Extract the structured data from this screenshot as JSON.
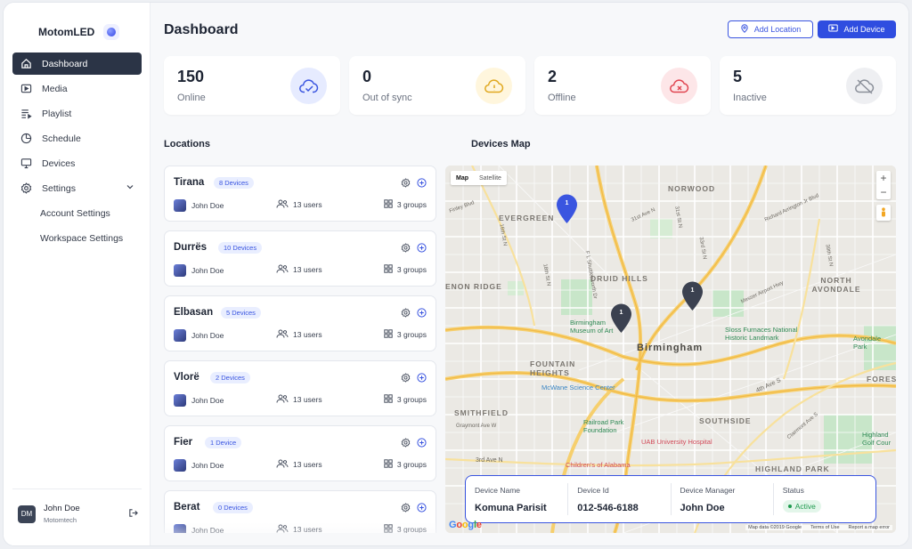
{
  "brand": {
    "name": "MotomLED"
  },
  "sidebar": {
    "items": [
      {
        "label": "Dashboard",
        "icon": "home-icon"
      },
      {
        "label": "Media",
        "icon": "media-icon"
      },
      {
        "label": "Playlist",
        "icon": "playlist-icon"
      },
      {
        "label": "Schedule",
        "icon": "schedule-icon"
      },
      {
        "label": "Devices",
        "icon": "monitor-icon"
      },
      {
        "label": "Settings",
        "icon": "gear-icon"
      }
    ],
    "sub_items": [
      {
        "label": "Account Settings"
      },
      {
        "label": "Workspace Settings"
      }
    ],
    "user": {
      "initials": "DM",
      "name": "John Doe",
      "company": "Motomtech"
    }
  },
  "header": {
    "title": "Dashboard",
    "add_location_label": "Add Location",
    "add_device_label": "Add Device"
  },
  "stats": [
    {
      "value": "150",
      "label": "Online",
      "icon": "cloud-check-icon",
      "color": "#3a55e0",
      "bg": "#e6ebff"
    },
    {
      "value": "0",
      "label": "Out of sync",
      "icon": "cloud-alert-icon",
      "color": "#e0a81f",
      "bg": "#fff6dd"
    },
    {
      "value": "2",
      "label": "Offline",
      "icon": "cloud-x-icon",
      "color": "#e04450",
      "bg": "#fde6e8"
    },
    {
      "value": "5",
      "label": "Inactive",
      "icon": "cloud-off-icon",
      "color": "#8a8f99",
      "bg": "#eeeff2"
    }
  ],
  "locations": {
    "title": "Locations",
    "items": [
      {
        "city": "Tirana",
        "devices": "8 Devices",
        "owner": "John Doe",
        "users": "13 users",
        "groups": "3 groups"
      },
      {
        "city": "Durrës",
        "devices": "10 Devices",
        "owner": "John Doe",
        "users": "13 users",
        "groups": "3 groups"
      },
      {
        "city": "Elbasan",
        "devices": "5 Devices",
        "owner": "John Doe",
        "users": "13 users",
        "groups": "3 groups"
      },
      {
        "city": "Vlorë",
        "devices": "2 Devices",
        "owner": "John Doe",
        "users": "13 users",
        "groups": "3 groups"
      },
      {
        "city": "Fier",
        "devices": "1 Device",
        "owner": "John Doe",
        "users": "13 users",
        "groups": "3 groups"
      },
      {
        "city": "Berat",
        "devices": "0 Devices",
        "owner": "John Doe",
        "users": "13 users",
        "groups": "3 groups"
      }
    ]
  },
  "map": {
    "title": "Devices Map",
    "toggle": {
      "map": "Map",
      "satellite": "Satellite"
    },
    "zoom_in": "+",
    "zoom_out": "−",
    "labels": {
      "norwood": "NORWOOD",
      "evergreen": "EVERGREEN",
      "druid_hills": "DRUID HILLS",
      "enon_ridge": "ENON RIDGE",
      "north_avondale": "NORTH AVONDALE",
      "birmingham": "Birmingham",
      "fountain_heights": "FOUNTAIN HEIGHTS",
      "smithfield": "SMITHFIELD",
      "southside": "SOUTHSIDE",
      "highland_park": "HIGHLAND PARK",
      "fores": "FORES",
      "museum": "Birmingham Museum of Art",
      "sloss": "Sloss Furnaces National Historic Landmark",
      "mcwane": "McWane Science Center",
      "railroad": "Railroad Park Foundation",
      "uab": "UAB University Hospital",
      "childrens": "Children's of Alabama",
      "avondale_park": "Avondale Park",
      "highland_golf": "Highland Golf Cour",
      "finley": "Finley Blvd",
      "ave_31": "31st Ave N",
      "st_16": "16th St N",
      "st_18": "18th St N",
      "st_31": "31st St N",
      "st_33": "33rd St N",
      "st_39": "39th St N",
      "richard_arrington": "Richard Arrington Jr Blvd",
      "messer": "Messer Airport Hwy",
      "shuttlesworth": "F L Shuttlesworth Dr",
      "ave_4th": "4th Ave S",
      "ave_3rd": "3rd Ave N",
      "graymont": "Graymont Ave W",
      "clairmont": "Clairmont Ave S"
    },
    "pins": [
      {
        "count": "1",
        "color": "#3a55e0"
      },
      {
        "count": "1",
        "color": "#3b4150"
      },
      {
        "count": "1",
        "color": "#3b4150"
      }
    ],
    "info": {
      "device_name_label": "Device Name",
      "device_name": "Komuna Parisit",
      "device_id_label": "Device Id",
      "device_id": "012-546-6188",
      "manager_label": "Device Manager",
      "manager": "John Doe",
      "status_label": "Status",
      "status": "Active"
    },
    "google": "Google",
    "footer": {
      "data": "Map data ©2019 Google",
      "terms": "Terms of Use",
      "report": "Report a map error"
    }
  }
}
